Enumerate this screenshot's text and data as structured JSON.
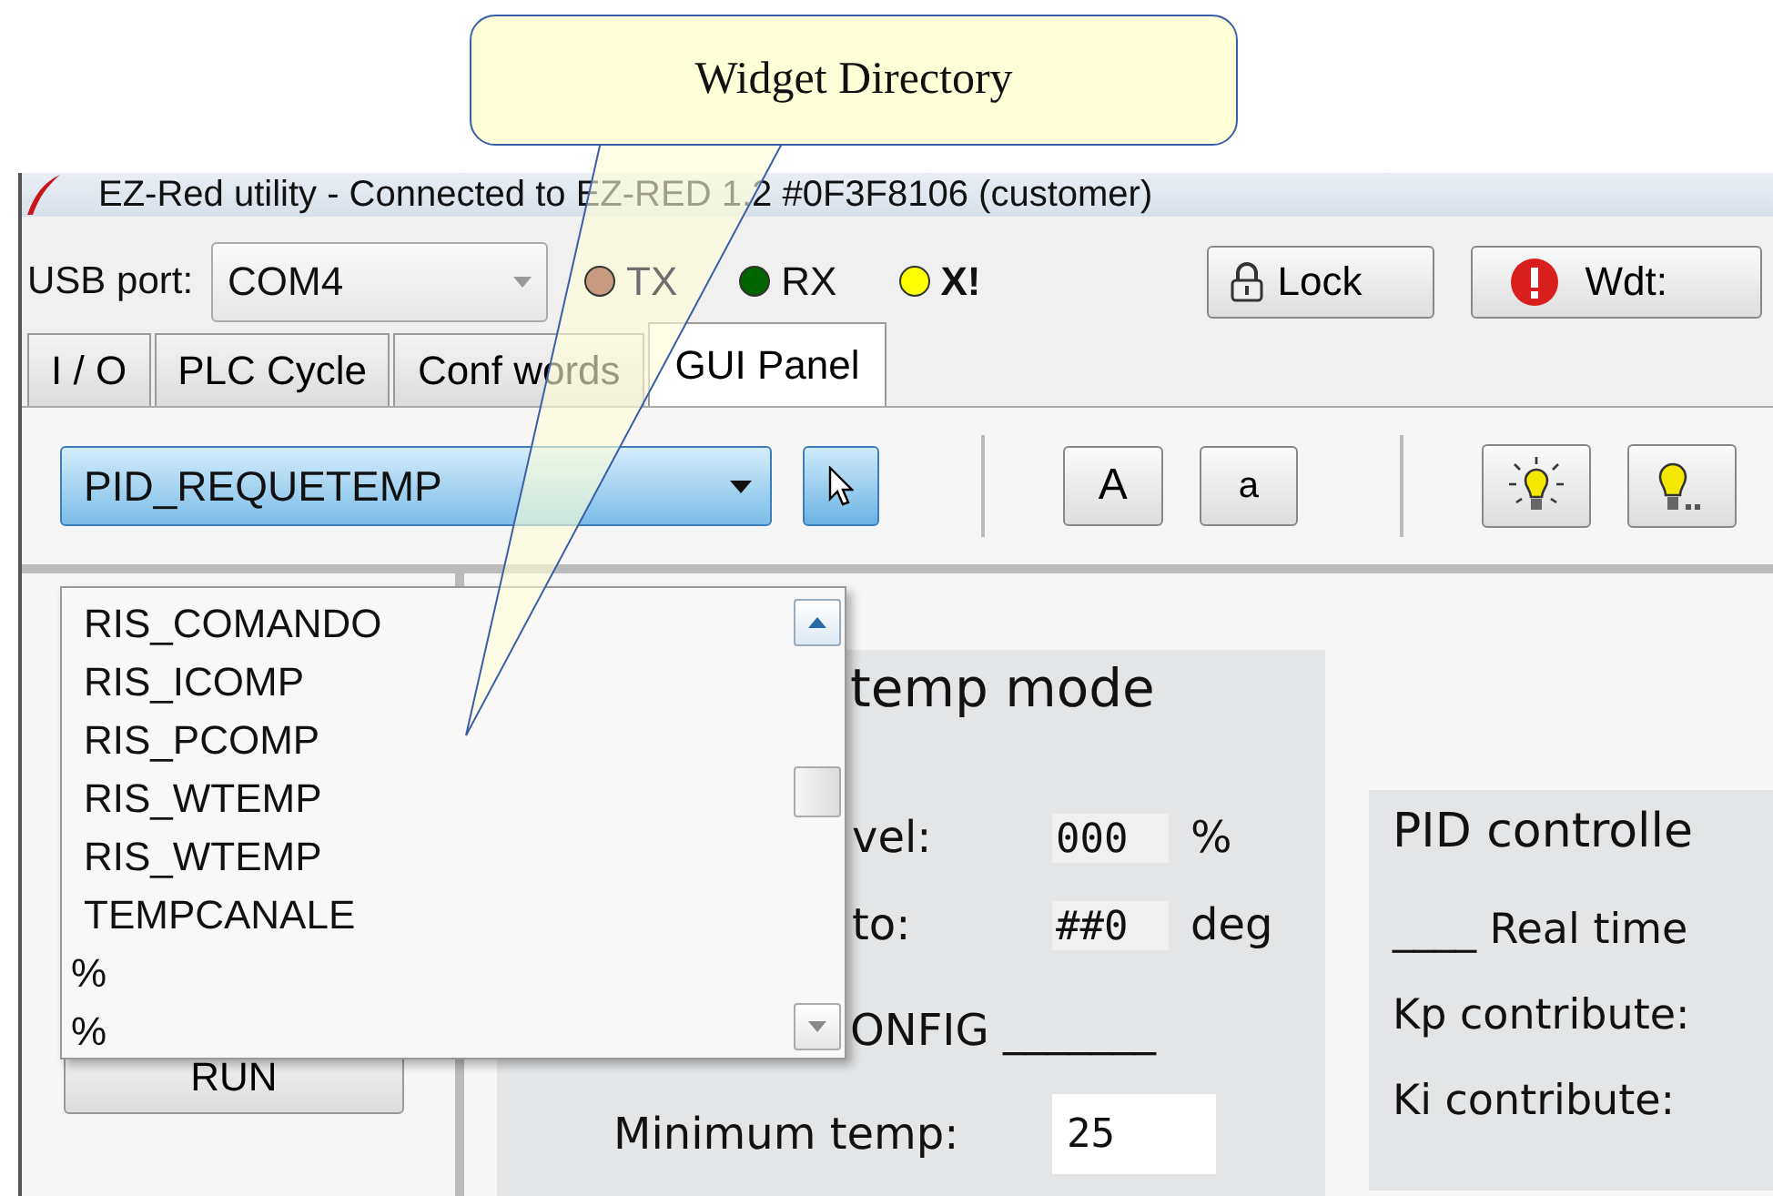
{
  "callout": {
    "text": "Widget Directory"
  },
  "window": {
    "title": "EZ-Red utility - Connected to EZ-RED 1.2  #0F3F8106 (customer)"
  },
  "toolbar": {
    "port_label": "USB port:",
    "port_value": "COM4",
    "indicators": [
      {
        "label": "TX",
        "color": "#c89a80",
        "disabled": true,
        "bold": false
      },
      {
        "label": "RX",
        "color": "#006400",
        "disabled": false,
        "bold": false
      },
      {
        "label": "X!",
        "color": "#ffff00",
        "disabled": false,
        "bold": true
      }
    ],
    "buttons": [
      {
        "label": "Lock",
        "kind": "lock"
      },
      {
        "label": "Wdt:",
        "kind": "alert"
      }
    ]
  },
  "tabs": [
    {
      "label": "I / O",
      "selected": false
    },
    {
      "label": "PLC Cycle",
      "selected": false
    },
    {
      "label": "Conf words",
      "selected": false
    },
    {
      "label": "GUI Panel",
      "selected": true
    }
  ],
  "gui_toolbar": {
    "widget_select": "PID_REQUETEMP",
    "pointer_selected": true,
    "font_buttons": [
      "A",
      "a"
    ],
    "bulb_buttons": [
      {
        "kind": "rays"
      },
      {
        "kind": "dots"
      }
    ]
  },
  "dropdown_list": {
    "items": [
      "RIS_COMANDO",
      "RIS_ICOMP",
      "RIS_PCOMP",
      "RIS_WTEMP",
      "RIS_WTEMP",
      "TEMPCANALE",
      "%",
      "%"
    ]
  },
  "left_pane": {
    "run_button": "RUN"
  },
  "temp_group": {
    "title": "temp mode",
    "rows": [
      {
        "label": "vel:",
        "value": "000",
        "unit": "%"
      },
      {
        "label": "to:",
        "value": "##0",
        "unit": "deg"
      }
    ],
    "config_heading": "ONFIG _______",
    "min_temp": {
      "label": "Minimum temp:",
      "value": "25"
    }
  },
  "pid_group": {
    "title": "PID controlle",
    "lines": [
      "____ Real time",
      "Kp contribute:",
      "Ki contribute:"
    ]
  }
}
